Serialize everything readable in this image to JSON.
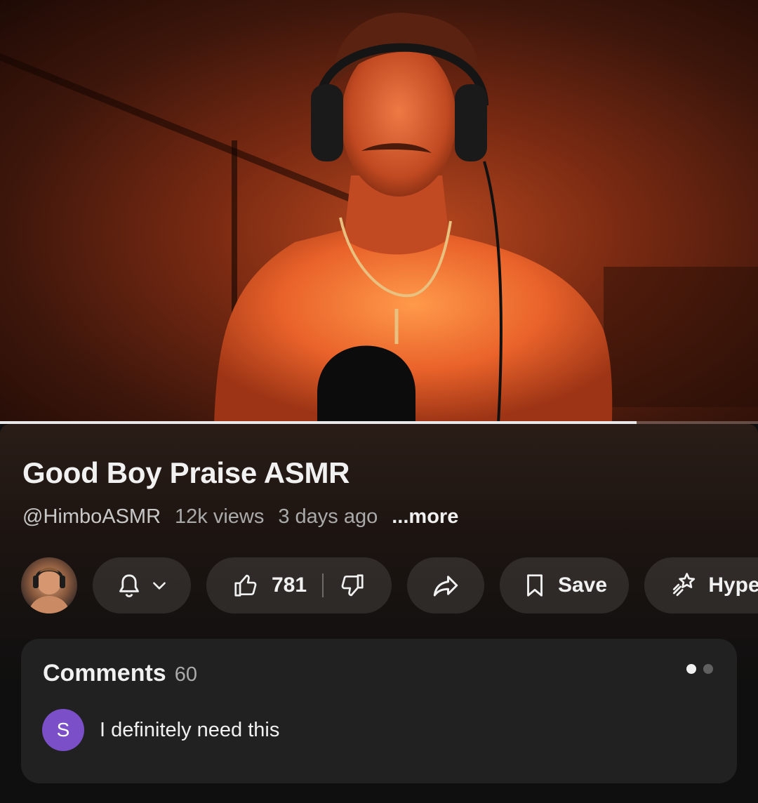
{
  "player": {
    "progress_percent": 84
  },
  "video": {
    "title": "Good Boy Praise ASMR",
    "channel": "@HimboASMR",
    "views": "12k views",
    "posted": "3 days ago",
    "more_label": "...more"
  },
  "actions": {
    "like_count": "781",
    "save_label": "Save",
    "hype_label": "Hype"
  },
  "comments": {
    "label": "Comments",
    "count": "60",
    "pages": 2,
    "active_page": 1,
    "top_comment": {
      "avatar_letter": "S",
      "avatar_color": "#7a4fc7",
      "text": "I definitely need this"
    }
  }
}
